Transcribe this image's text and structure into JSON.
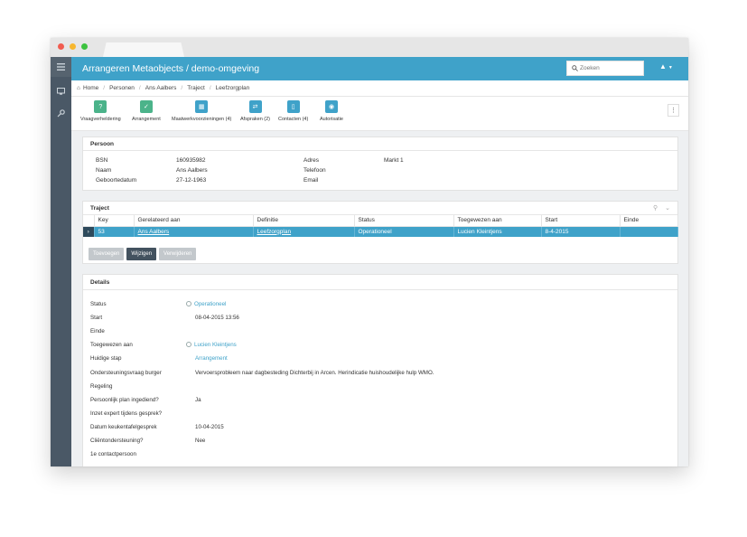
{
  "app": {
    "title": "Arrangeren Metaobjects / demo-omgeving"
  },
  "search": {
    "placeholder": "Zoeken",
    "value": ""
  },
  "breadcrumb": [
    "Home",
    "Personen",
    "Ans Aalbers",
    "Traject",
    "Leefzorgplan"
  ],
  "toolbar": [
    {
      "label": "Vraagverheldering",
      "icon": "question-icon"
    },
    {
      "label": "Arrangement",
      "icon": "check-list-icon"
    },
    {
      "label": "Maatwerkvoorzieningen  (4)",
      "icon": "calculator-icon"
    },
    {
      "label": "Afspraken  (2)",
      "icon": "handshake-icon"
    },
    {
      "label": "Contacten  (4)",
      "icon": "contacts-icon"
    },
    {
      "label": "Autorisatie",
      "icon": "lock-icon"
    }
  ],
  "persoon": {
    "title": "Persoon",
    "left": [
      {
        "label": "BSN",
        "value": "160935982"
      },
      {
        "label": "Naam",
        "value": "Ans Aalbers"
      },
      {
        "label": "Geboortedatum",
        "value": "27-12-1963"
      }
    ],
    "right": [
      {
        "label": "Adres",
        "value": "Markt 1"
      },
      {
        "label": "Telefoon",
        "value": ""
      },
      {
        "label": "Email",
        "value": ""
      }
    ]
  },
  "traject": {
    "title": "Traject",
    "columns": [
      "Key",
      "Gerelateerd aan",
      "Definitie",
      "Status",
      "Toegewezen aan",
      "Start",
      "Einde"
    ],
    "rows": [
      {
        "key": "53",
        "gerelateerd": "Ans Aalbers",
        "definitie": "Leefzorgplan",
        "status": "Operationeel",
        "toegewezen": "Lucien Kleintjens",
        "start": "8-4-2015",
        "einde": ""
      }
    ],
    "buttons": {
      "toevoegen": "Toevoegen",
      "wijzigen": "Wijzigen",
      "verwijderen": "Verwijderen"
    }
  },
  "details": {
    "title": "Details",
    "rows": [
      {
        "label": "Status",
        "value": "Operationeel",
        "link": true,
        "clock": true
      },
      {
        "label": "Start",
        "value": "08-04-2015 13:56"
      },
      {
        "label": "Einde",
        "value": ""
      },
      {
        "label": "Toegewezen aan",
        "value": "Lucien Kleintjens",
        "link": true,
        "clock": true
      },
      {
        "label": "Huidige stap",
        "value": "Arrangement",
        "link": true
      },
      {
        "label": "Ondersteuningsvraag burger",
        "value": "Vervoersprobleem naar dagbesteding Dichterbij in Arcen. Herindicatie huishoudelijke hulp WMO."
      },
      {
        "label": "Regeling",
        "value": ""
      },
      {
        "label": "Persoonlijk plan ingediend?",
        "value": "Ja"
      },
      {
        "label": "Inzet expert tijdens gesprek?",
        "value": ""
      },
      {
        "label": "Datum keukentafelgesprek",
        "value": "10-04-2015"
      },
      {
        "label": "Cliëntondersteuning?",
        "value": "Nee"
      },
      {
        "label": "1e contactpersoon",
        "value": ""
      }
    ]
  },
  "colors": {
    "accent": "#3fa2c9",
    "sidebar": "#4a5866",
    "green": "#4bb38a"
  }
}
